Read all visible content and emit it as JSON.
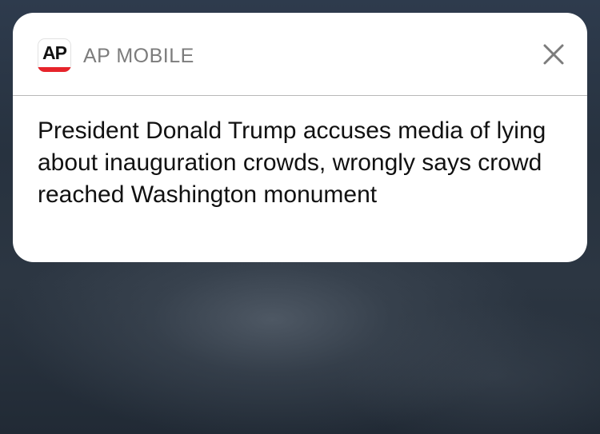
{
  "notification": {
    "app_name": "AP MOBILE",
    "app_icon": {
      "icon": "ap-app-icon",
      "text": "AP",
      "accent_color": "#e6242b"
    },
    "close_icon": "close-icon",
    "message": "President Donald Trump accuses media of lying about inauguration crowds, wrongly says crowd reached Washington monument"
  }
}
